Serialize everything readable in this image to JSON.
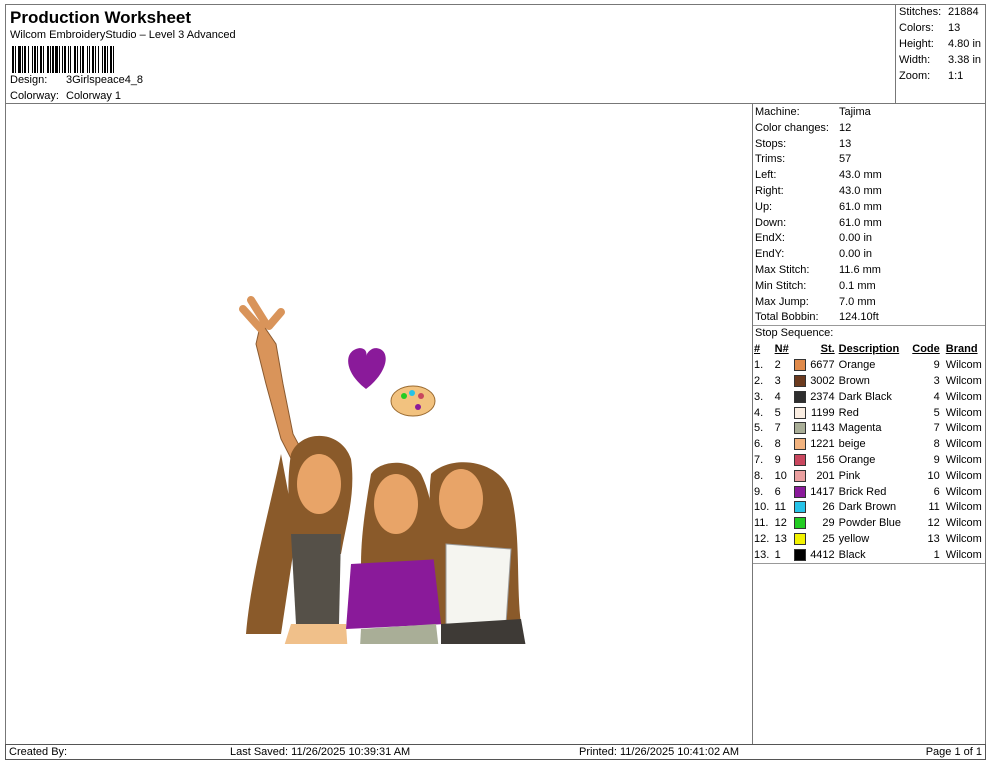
{
  "header": {
    "title": "Production Worksheet",
    "subtitle": "Wilcom EmbroideryStudio – Level 3 Advanced",
    "design_label": "Design:",
    "design_value": "3Girlspeace4_8",
    "colorway_label": "Colorway:",
    "colorway_value": "Colorway 1"
  },
  "summary": [
    {
      "label": "Stitches:",
      "value": "21884"
    },
    {
      "label": "Colors:",
      "value": "13"
    },
    {
      "label": "Height:",
      "value": "4.80 in"
    },
    {
      "label": "Width:",
      "value": "3.38 in"
    },
    {
      "label": "Zoom:",
      "value": "1:1"
    }
  ],
  "machine_info": [
    {
      "label": "Machine:",
      "value": "Tajima"
    },
    {
      "label": "Color changes:",
      "value": "12"
    },
    {
      "label": "Stops:",
      "value": "13"
    },
    {
      "label": "Trims:",
      "value": "57"
    },
    {
      "label": "Left:",
      "value": "43.0 mm"
    },
    {
      "label": "Right:",
      "value": "43.0 mm"
    },
    {
      "label": "Up:",
      "value": "61.0 mm"
    },
    {
      "label": "Down:",
      "value": "61.0 mm"
    },
    {
      "label": "EndX:",
      "value": "0.00 in"
    },
    {
      "label": "EndY:",
      "value": "0.00 in"
    },
    {
      "label": "Max Stitch:",
      "value": "11.6 mm"
    },
    {
      "label": "Min Stitch:",
      "value": "0.1 mm"
    },
    {
      "label": "Max Jump:",
      "value": "7.0 mm"
    },
    {
      "label": "Total Bobbin:",
      "value": "124.10ft"
    }
  ],
  "stop_sequence": {
    "title": "Stop Sequence:",
    "headers": {
      "idx": "#",
      "n": "N#",
      "st": "St.",
      "desc": "Description",
      "code": "Code",
      "brand": "Brand"
    },
    "rows": [
      {
        "idx": "1.",
        "n": "2",
        "color": "#E08A4A",
        "st": "6677",
        "desc": "Orange",
        "code": "9",
        "brand": "Wilcom"
      },
      {
        "idx": "2.",
        "n": "3",
        "color": "#6B3A1E",
        "st": "3002",
        "desc": "Brown",
        "code": "3",
        "brand": "Wilcom"
      },
      {
        "idx": "3.",
        "n": "4",
        "color": "#2E2E2E",
        "st": "2374",
        "desc": "Dark Black",
        "code": "4",
        "brand": "Wilcom"
      },
      {
        "idx": "4.",
        "n": "5",
        "color": "#FBEEE2",
        "st": "1199",
        "desc": "Red",
        "code": "5",
        "brand": "Wilcom"
      },
      {
        "idx": "5.",
        "n": "7",
        "color": "#A9AE97",
        "st": "1143",
        "desc": "Magenta",
        "code": "7",
        "brand": "Wilcom"
      },
      {
        "idx": "6.",
        "n": "8",
        "color": "#F2B37F",
        "st": "1221",
        "desc": "beige",
        "code": "8",
        "brand": "Wilcom"
      },
      {
        "idx": "7.",
        "n": "9",
        "color": "#C9475E",
        "st": "156",
        "desc": "Orange",
        "code": "9",
        "brand": "Wilcom"
      },
      {
        "idx": "8.",
        "n": "10",
        "color": "#EBA0A0",
        "st": "201",
        "desc": "Pink",
        "code": "10",
        "brand": "Wilcom"
      },
      {
        "idx": "9.",
        "n": "6",
        "color": "#8A1A9A",
        "st": "1417",
        "desc": "Brick Red",
        "code": "6",
        "brand": "Wilcom"
      },
      {
        "idx": "10.",
        "n": "11",
        "color": "#26C3E8",
        "st": "26",
        "desc": "Dark Brown",
        "code": "11",
        "brand": "Wilcom"
      },
      {
        "idx": "11.",
        "n": "12",
        "color": "#22CC22",
        "st": "29",
        "desc": "Powder Blue",
        "code": "12",
        "brand": "Wilcom"
      },
      {
        "idx": "12.",
        "n": "13",
        "color": "#F2F200",
        "st": "25",
        "desc": "yellow",
        "code": "13",
        "brand": "Wilcom"
      },
      {
        "idx": "13.",
        "n": "1",
        "color": "#000000",
        "st": "4412",
        "desc": "Black",
        "code": "1",
        "brand": "Wilcom"
      }
    ]
  },
  "footer": {
    "created_by": "Created By:",
    "last_saved": "Last Saved: 11/26/2025 10:39:31 AM",
    "printed": "Printed: 11/26/2025 10:41:02 AM",
    "page": "Page 1 of 1"
  }
}
